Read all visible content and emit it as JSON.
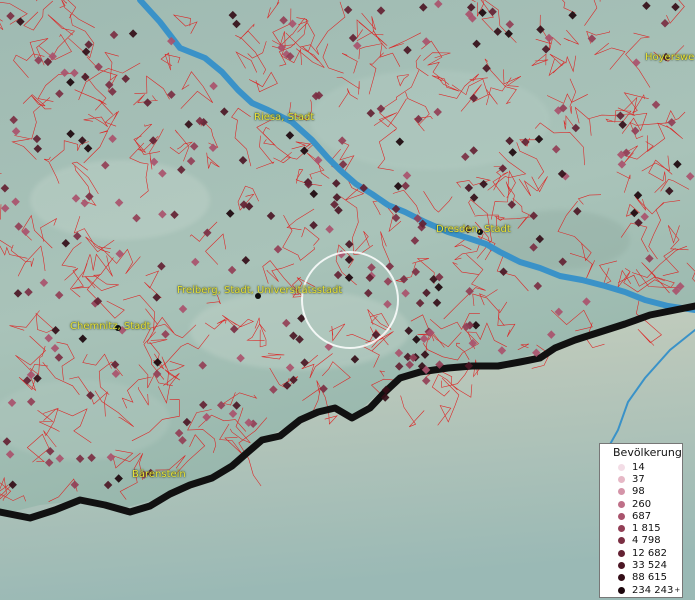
{
  "map": {
    "cities": [
      {
        "id": "riesa",
        "label": "Riesa, Stadt"
      },
      {
        "id": "dresden",
        "label": "Dresden, Stadt"
      },
      {
        "id": "freiberg",
        "label": "Freiberg, Stadt, Universitätsstadt"
      },
      {
        "id": "chemnitz",
        "label": "Chemnitz, Stadt"
      },
      {
        "id": "baerenstein",
        "label": "Bärenstein"
      },
      {
        "id": "hoyerswerda",
        "label": "Hoyerswe"
      }
    ],
    "colors": {
      "boundary": "#e01818",
      "river": "#3a92c8",
      "border": "#111111",
      "label": "#e8e23a"
    }
  },
  "legend": {
    "title": "Bevölkerung",
    "items": [
      {
        "label": "14",
        "color": "#f3dde6"
      },
      {
        "label": "37",
        "color": "#e6b8c6"
      },
      {
        "label": "98",
        "color": "#d494a8"
      },
      {
        "label": "260",
        "color": "#bf7088"
      },
      {
        "label": "687",
        "color": "#a9536c"
      },
      {
        "label": "1 815",
        "color": "#923f56"
      },
      {
        "label": "4 798",
        "color": "#7b2f43"
      },
      {
        "label": "12 682",
        "color": "#642233"
      },
      {
        "label": "33 524",
        "color": "#4c1725"
      },
      {
        "label": "88 615",
        "color": "#340e18"
      },
      {
        "label": "234 243",
        "color": "#1c060c",
        "sup": "+"
      }
    ]
  }
}
